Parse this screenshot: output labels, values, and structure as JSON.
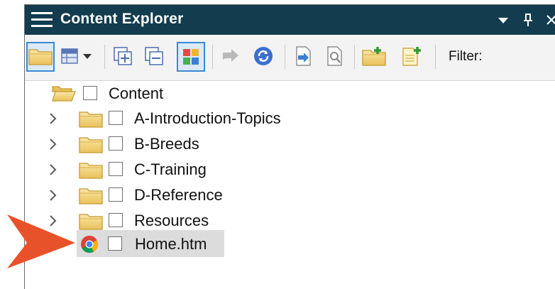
{
  "window": {
    "title": "Content Explorer",
    "title_bg": "#133c4e"
  },
  "toolbar": {
    "filter_label": "Filter:",
    "selected_border": "#3a8ad4"
  },
  "tree": {
    "root": {
      "label": "Content",
      "icon": "open-folder-icon"
    },
    "items": [
      {
        "label": "A-Introduction-Topics",
        "icon": "folder-icon",
        "expandable": true
      },
      {
        "label": "B-Breeds",
        "icon": "folder-icon",
        "expandable": true
      },
      {
        "label": "C-Training",
        "icon": "folder-icon",
        "expandable": true
      },
      {
        "label": "D-Reference",
        "icon": "folder-icon",
        "expandable": true
      },
      {
        "label": "Resources",
        "icon": "folder-icon",
        "expandable": true
      },
      {
        "label": "Home.htm",
        "icon": "chrome-icon",
        "expandable": false,
        "selected": true
      }
    ]
  },
  "callout": {
    "color": "#e8522a"
  }
}
